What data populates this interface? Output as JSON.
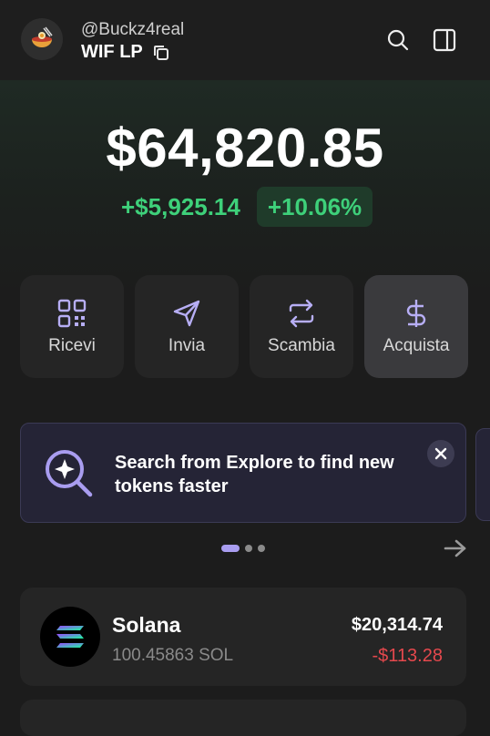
{
  "header": {
    "handle": "@Buckz4real",
    "account_name": "WIF LP"
  },
  "balance": {
    "total": "$64,820.85",
    "change": "+$5,925.14",
    "change_pct": "+10.06%"
  },
  "actions": [
    {
      "label": "Ricevi",
      "icon": "qr-code-icon"
    },
    {
      "label": "Invia",
      "icon": "send-icon"
    },
    {
      "label": "Scambia",
      "icon": "swap-icon"
    },
    {
      "label": "Acquista",
      "icon": "dollar-icon"
    }
  ],
  "banner": {
    "text": "Search from Explore to find new tokens faster"
  },
  "tokens": [
    {
      "name": "Solana",
      "amount": "100.45863 SOL",
      "value": "$20,314.74",
      "change": "-$113.28"
    }
  ],
  "colors": {
    "positive": "#3ed07a",
    "negative": "#e5484d",
    "accent": "#a99df0",
    "background": "#1c1c1c"
  }
}
